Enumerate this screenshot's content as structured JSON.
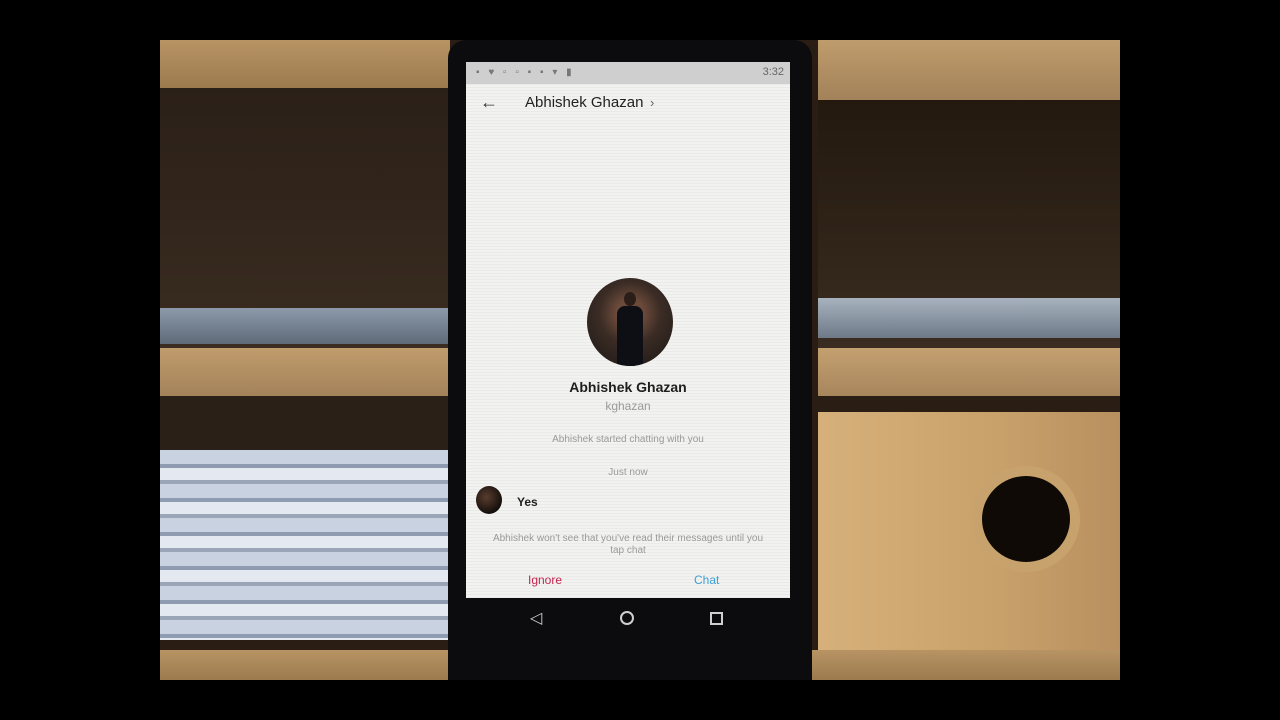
{
  "statusbar": {
    "time": "3:32",
    "icons": "▪ ♥ ▫ ▫ ▪ ▪ ▾ ▮"
  },
  "appbar": {
    "back_icon": "←",
    "title": "Abhishek Ghazan",
    "chevron": "›"
  },
  "profile": {
    "name": "Abhishek Ghazan",
    "handle": "kghazan"
  },
  "conversation": {
    "started_text": "Abhishek started chatting with you",
    "timestamp": "Just now",
    "message": "Yes",
    "notice": "Abhishek won't see that you've read their messages until you tap chat"
  },
  "actions": {
    "ignore_label": "Ignore",
    "chat_label": "Chat"
  },
  "navbar": {
    "back_icon": "◁"
  },
  "colors": {
    "ignore": "#c4264e",
    "chat": "#3d9fd8"
  }
}
